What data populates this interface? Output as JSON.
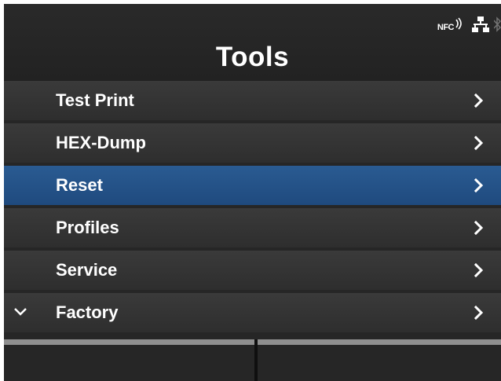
{
  "header": {
    "title": "Tools",
    "status": {
      "nfc_label": "NFC",
      "nfc_icon": "nfc-icon",
      "network_icon": "network-icon",
      "bluetooth_icon": "bluetooth-icon"
    }
  },
  "menu": {
    "items": [
      {
        "label": "Test Print",
        "selected": false
      },
      {
        "label": "HEX-Dump",
        "selected": false
      },
      {
        "label": "Reset",
        "selected": true
      },
      {
        "label": "Profiles",
        "selected": false
      },
      {
        "label": "Service",
        "selected": false
      },
      {
        "label": "Factory",
        "selected": false
      }
    ]
  },
  "colors": {
    "background": "#262626",
    "row": "#353535",
    "selected_row": "#255289",
    "softkey_line": "#8f8f8f",
    "text": "#ffffff"
  },
  "softkeys": {
    "left": "",
    "right": ""
  }
}
